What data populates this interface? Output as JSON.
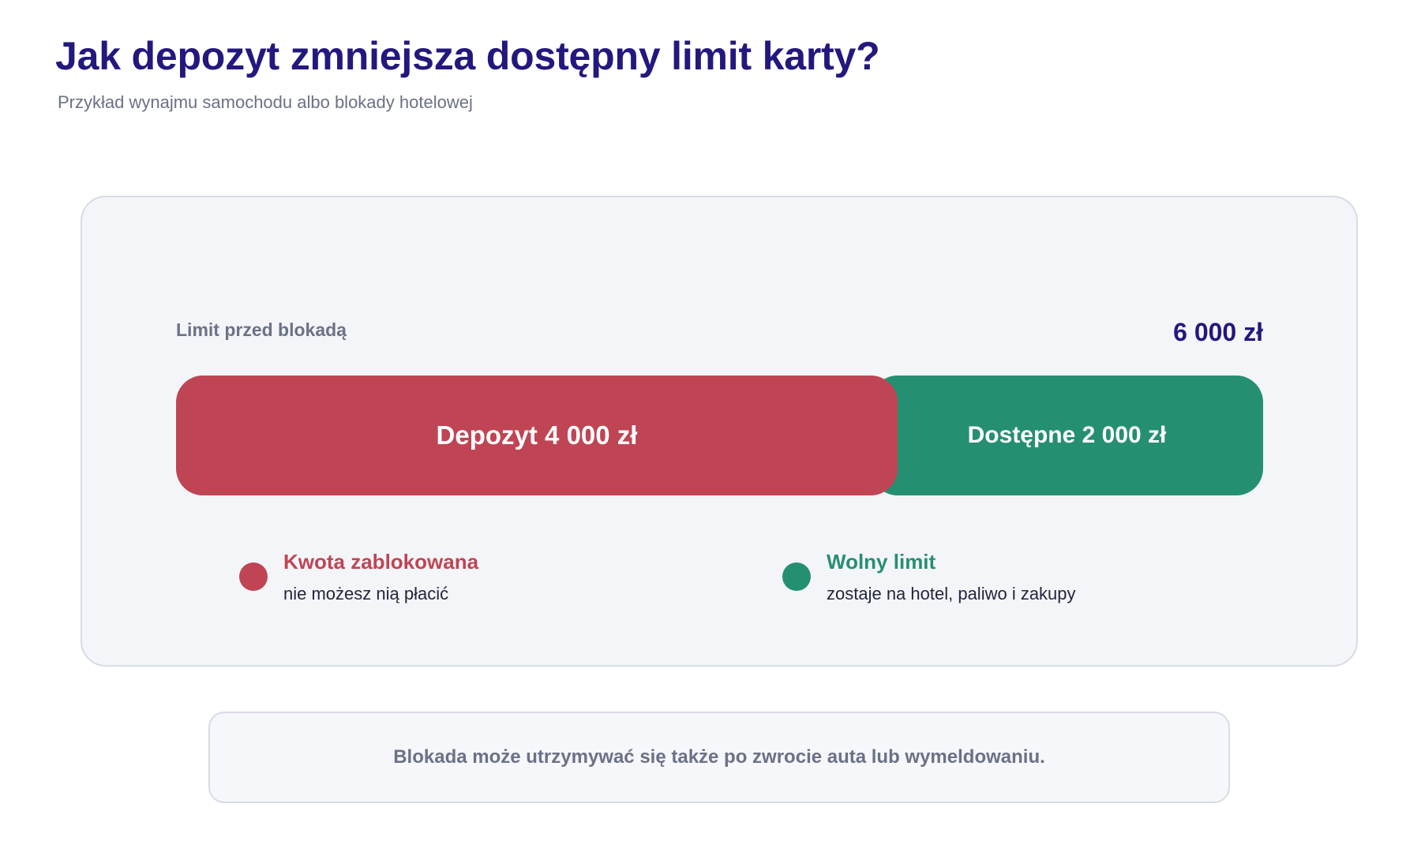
{
  "header": {
    "title": "Jak depozyt zmniejsza dostępny limit karty?",
    "subtitle": "Przykład wynajmu samochodu albo blokady hotelowej"
  },
  "limit": {
    "label": "Limit przed blokadą",
    "total_text": "6 000 zł",
    "total_value": 6000,
    "currency": "zł"
  },
  "bar": {
    "segments": [
      {
        "key": "deposit",
        "label": "Depozyt 4 000 zł",
        "value": 4000,
        "color": "#bf4554"
      },
      {
        "key": "available",
        "label": "Dostępne 2 000 zł",
        "value": 2000,
        "color": "#258f71"
      }
    ]
  },
  "legend": {
    "blocked": {
      "title": "Kwota zablokowana",
      "description": "nie możesz nią płacić",
      "color": "#bf4554"
    },
    "free": {
      "title": "Wolny limit",
      "description": "zostaje na hotel, paliwo i zakupy",
      "color": "#258f71"
    }
  },
  "note": {
    "text": "Blokada może utrzymywać się także po zwrocie auta lub wymeldowaniu."
  },
  "colors": {
    "title": "#22187e",
    "muted": "#6b7186",
    "panel_bg": "#f4f5f9",
    "panel_border": "#d7dbe7"
  }
}
